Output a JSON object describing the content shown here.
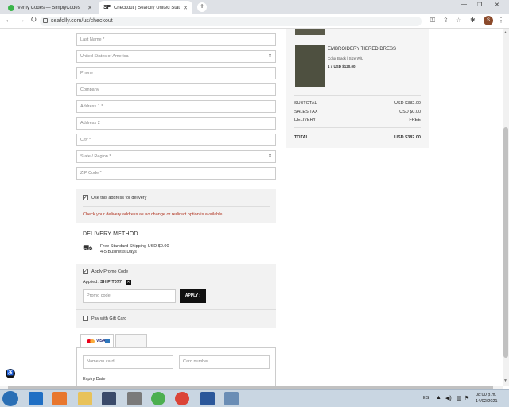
{
  "browser": {
    "tabs": [
      {
        "title": "Verify Codes — SimplyCodes",
        "favicon": "simplycodes-icon"
      },
      {
        "title": "Checkout | Seafolly United States",
        "favicon_text": "SF"
      }
    ],
    "url": "seafolly.com/us/checkout",
    "profile_initial": "S"
  },
  "form": {
    "last_name": "Last Name *",
    "country": "United States of America",
    "phone": "Phone",
    "company": "Company",
    "address1": "Address 1 *",
    "address2": "Address 2",
    "city": "City *",
    "state": "State / Region *",
    "zip": "ZIP Code *"
  },
  "delivery_address": {
    "checkbox_label": "Use this address for delivery",
    "warning": "Check your delivery address as no change or redirect option is available"
  },
  "delivery_method": {
    "heading": "DELIVERY METHOD",
    "option_title": "Free Standard Shipping USD $0.00",
    "option_days": "4-5 Business Days"
  },
  "promo": {
    "checkbox_label": "Apply Promo Code",
    "applied_label": "Applied:",
    "applied_code": "SHIPIT077",
    "input_placeholder": "Promo code",
    "apply_button": "APPLY ›"
  },
  "gift_card": {
    "label": "Pay with Gift Card"
  },
  "payment": {
    "name_placeholder": "Name on card",
    "number_placeholder": "Card number",
    "expiry_label": "Expiry Date"
  },
  "summary": {
    "product_name": "EMBROIDERY TIERED DRESS",
    "product_detail": "Color Black | Size W/L",
    "product_price": "1 x USD $120.00",
    "subtotal_label": "SUBTOTAL",
    "subtotal_value": "USD $382.00",
    "tax_label": "SALES TAX",
    "tax_value": "USD $0.00",
    "delivery_label": "DELIVERY",
    "delivery_value": "FREE",
    "total_label": "TOTAL",
    "total_value": "USD $382.00"
  },
  "taskbar": {
    "lang": "ES",
    "time": "08:00 p.m.",
    "date": "14/02/2021"
  },
  "colors": {
    "warning_red": "#b0331f",
    "button_black": "#111111",
    "panel_gray": "#f2f2f2"
  }
}
